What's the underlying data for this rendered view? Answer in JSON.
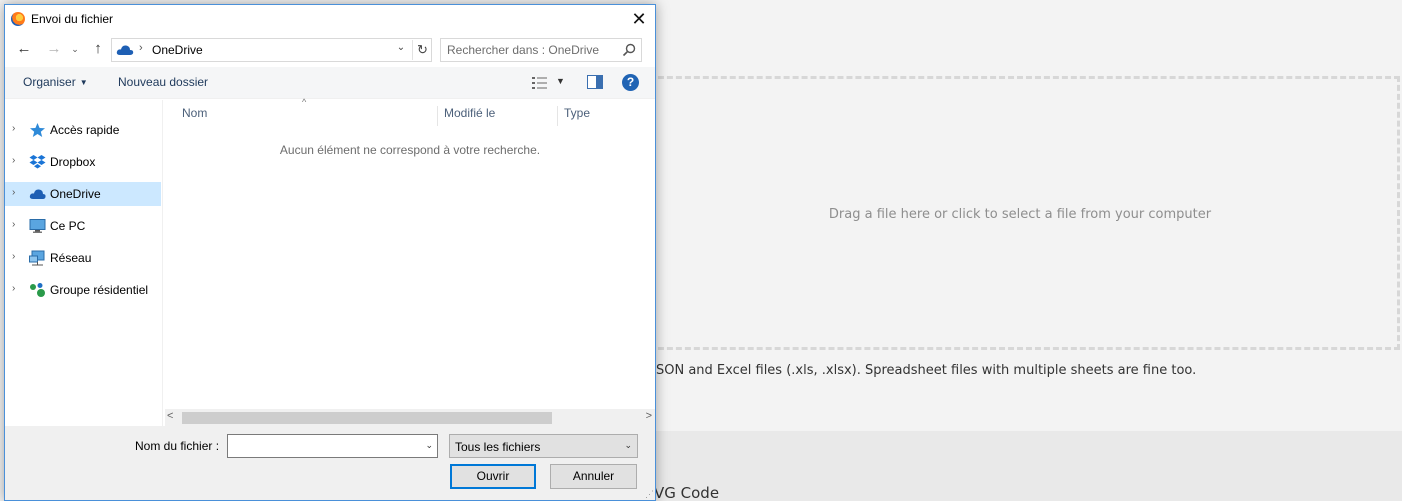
{
  "background": {
    "drop_zone_text": "Drag a file here or click to select a file from your computer",
    "supported_text": "SON and Excel files (.xls, .xlsx). Spreadsheet files with multiple sheets are fine too.",
    "section_heading": "VG Code"
  },
  "dialog": {
    "title": "Envoi du fichier",
    "close_glyph": "✕",
    "address": {
      "back_glyph": "←",
      "forward_glyph": "→",
      "recent_glyph": "⌄",
      "up_glyph": "↑",
      "separator": "›",
      "path": "OneDrive",
      "dropdown_glyph": "⌄",
      "refresh_glyph": "↻"
    },
    "search": {
      "placeholder": "Rechercher dans : OneDrive"
    },
    "toolbar": {
      "organiser": "Organiser",
      "organiser_caret": "▼",
      "new_folder": "Nouveau dossier",
      "view_caret": "▼",
      "help": "?"
    },
    "nav_pane": {
      "chevron": "›",
      "items": [
        {
          "label": "Accès rapide",
          "icon": "star-icon"
        },
        {
          "label": "Dropbox",
          "icon": "dropbox-icon"
        },
        {
          "label": "OneDrive",
          "icon": "onedrive-icon",
          "selected": true
        },
        {
          "label": "Ce PC",
          "icon": "computer-icon"
        },
        {
          "label": "Réseau",
          "icon": "network-icon"
        },
        {
          "label": "Groupe résidentiel",
          "icon": "homegroup-icon"
        }
      ]
    },
    "file_list": {
      "sort_arrow": "^",
      "columns": [
        "Nom",
        "Modifié le",
        "Type"
      ],
      "empty_message": "Aucun élément ne correspond à votre recherche.",
      "scroll_left": "<",
      "scroll_right": ">"
    },
    "footer": {
      "filename_label": "Nom du fichier :",
      "filename_value": "",
      "filename_caret": "⌄",
      "file_type": "Tous les fichiers",
      "file_type_caret": "⌄",
      "open_button": "Ouvrir",
      "cancel_button": "Annuler",
      "grip": "⋰"
    }
  },
  "colors": {
    "accent": "#0078d7",
    "selection": "#cce8ff",
    "help_blue": "#2064b4"
  }
}
